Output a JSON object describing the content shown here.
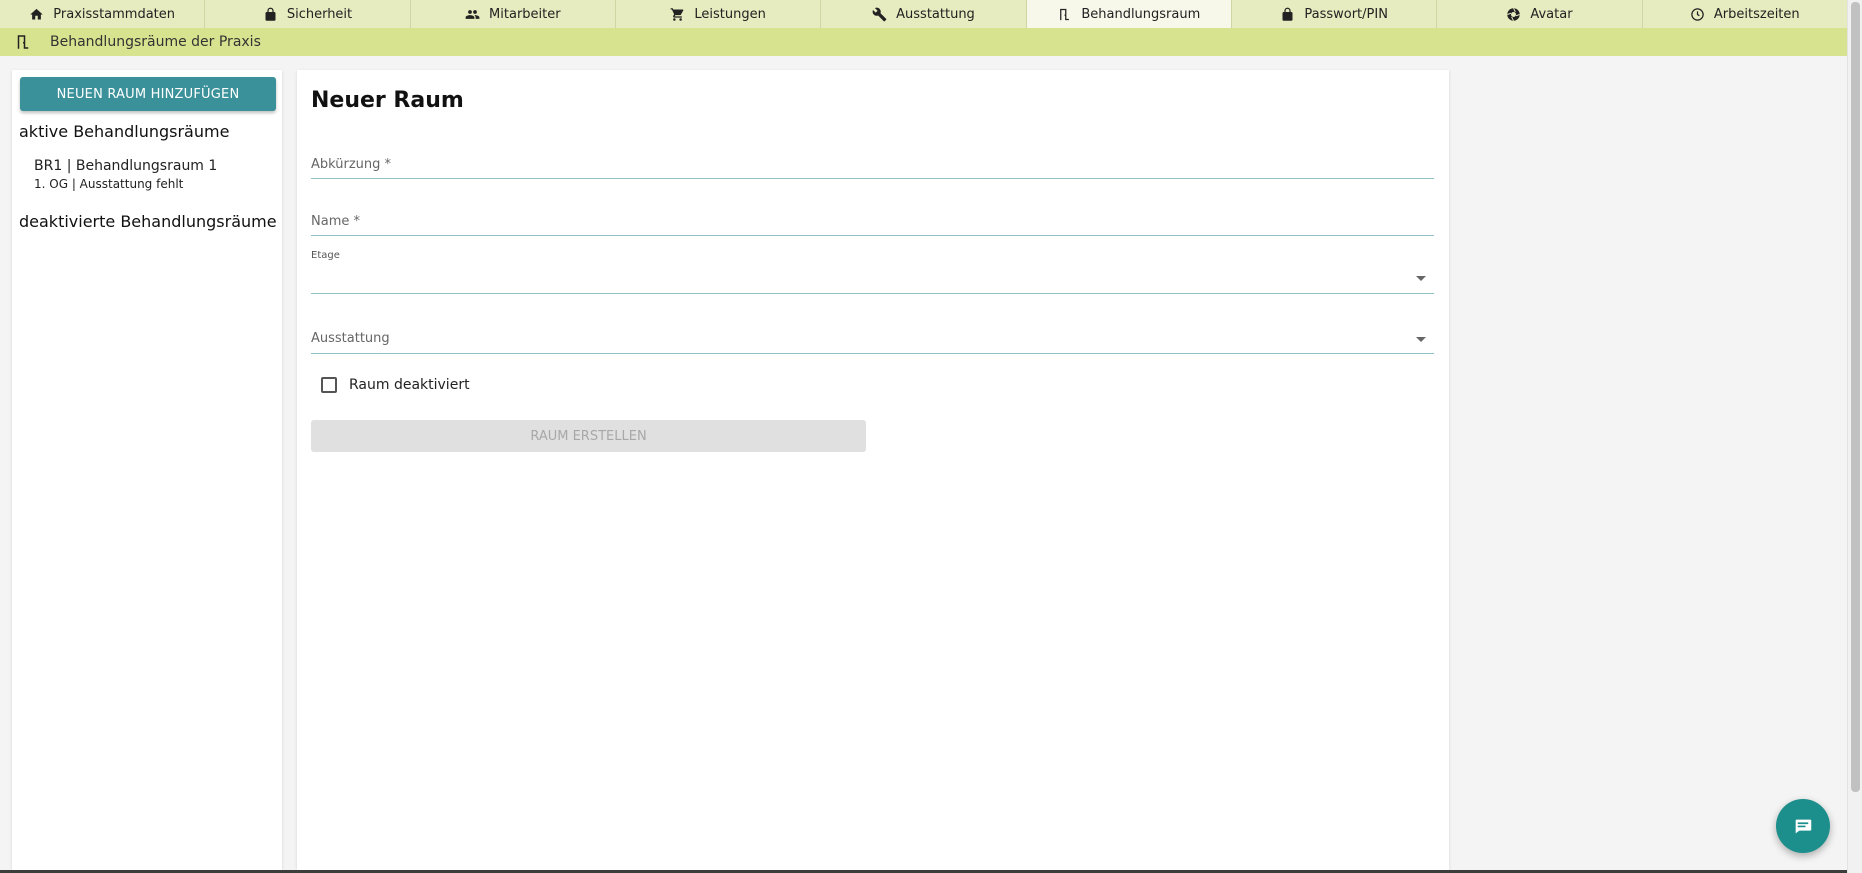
{
  "tabs": [
    {
      "label": "Praxisstammdaten",
      "icon": "home-icon",
      "active": false
    },
    {
      "label": "Sicherheit",
      "icon": "lock-icon",
      "active": false
    },
    {
      "label": "Mitarbeiter",
      "icon": "people-icon",
      "active": false
    },
    {
      "label": "Leistungen",
      "icon": "cart-icon",
      "active": false
    },
    {
      "label": "Ausstattung",
      "icon": "wrench-icon",
      "active": false
    },
    {
      "label": "Behandlungsraum",
      "icon": "door-icon",
      "active": true
    },
    {
      "label": "Passwort/PIN",
      "icon": "lock-icon",
      "active": false
    },
    {
      "label": "Avatar",
      "icon": "aperture-icon",
      "active": false
    },
    {
      "label": "Arbeitszeiten",
      "icon": "clock-icon",
      "active": false
    }
  ],
  "subheader": {
    "title": "Behandlungsräume der Praxis",
    "icon": "door-icon"
  },
  "sidebar": {
    "add_button": "NEUEN RAUM HINZUFÜGEN",
    "active_title": "aktive Behandlungsräume",
    "active_rooms": [
      {
        "line1": "BR1 | Behandlungsraum 1",
        "line2": "1. OG | Ausstattung fehlt"
      }
    ],
    "inactive_title": "deaktivierte Behandlungsräume"
  },
  "form": {
    "title": "Neuer Raum",
    "abbreviation_label": "Abkürzung *",
    "name_label": "Name *",
    "floor_label": "Etage",
    "floor_value": "",
    "equipment_label": "Ausstattung",
    "deactivated_label": "Raum deaktiviert",
    "deactivated_checked": false,
    "submit_label": "RAUM ERSTELLEN"
  },
  "colors": {
    "tabbar": "#e6ecbf",
    "subheader": "#d8e38f",
    "accent": "#3a9199",
    "chat": "#1c8f8c"
  },
  "chat": {
    "icon": "chat-icon"
  }
}
